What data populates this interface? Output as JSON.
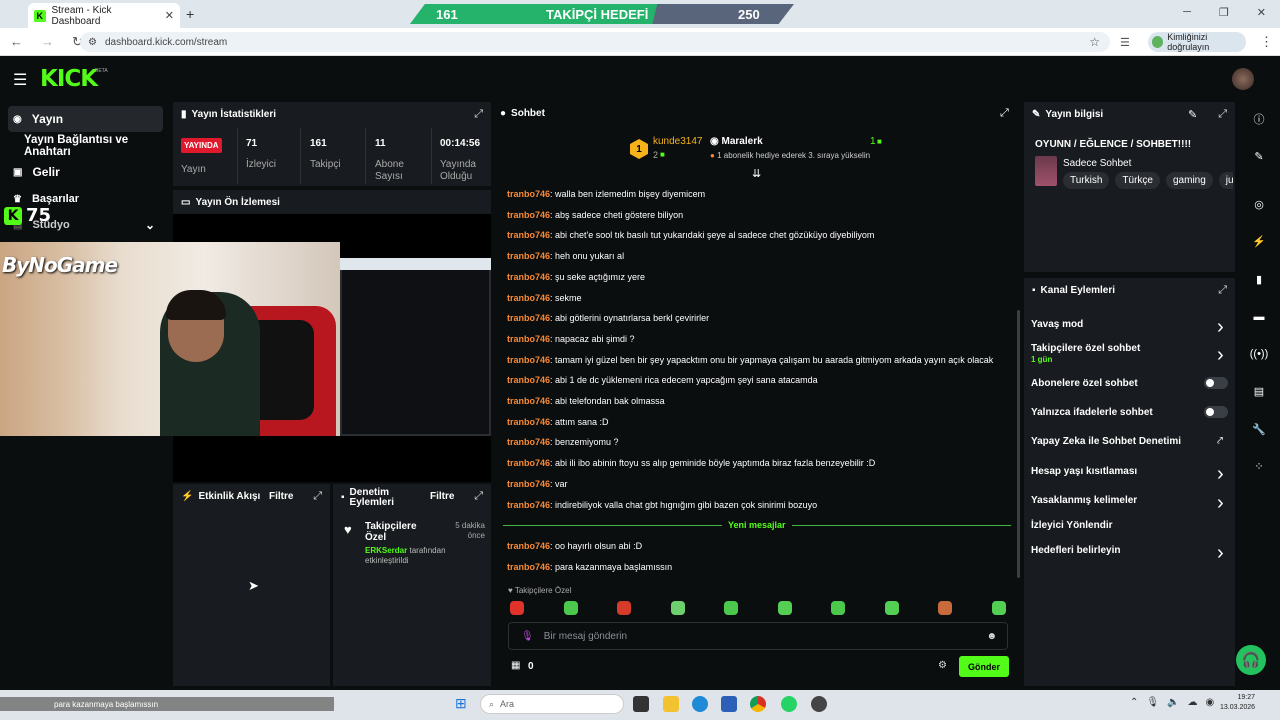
{
  "browser": {
    "tab_title": "Stream - Kick Dashboard",
    "url": "dashboard.kick.com/stream",
    "verify_label": "Kimliğinizi doğrulayın",
    "close_glyph": "✕",
    "newtab_glyph": "+"
  },
  "goal": {
    "current": "161",
    "label": "TAKİPÇİ HEDEFİ",
    "target": "250",
    "progress": 0.644
  },
  "kick": {
    "logo": "KICK",
    "beta": "BETA"
  },
  "sidebar": {
    "items": [
      {
        "label": "Yayın",
        "icon": "broadcast-icon"
      },
      {
        "label": "Yayın Bağlantısı ve Anahtarı",
        "icon": ""
      },
      {
        "label": "Gelir",
        "icon": "money-icon"
      },
      {
        "label": "Başarılar",
        "icon": "trophy-icon"
      },
      {
        "label": "Stüdyo",
        "icon": "studio-icon"
      }
    ],
    "overlay_count": "75"
  },
  "stats": {
    "title": "Yayın İstatistikleri",
    "live_badge": "YAYINDA",
    "live_label": "Yayın",
    "items": [
      {
        "value": "71",
        "label": "İzleyici"
      },
      {
        "value": "161",
        "label": "Takipçi"
      },
      {
        "value": "11",
        "label": "Abone Sayısı"
      },
      {
        "value": "00:14:56",
        "label": "Yayında Olduğu"
      }
    ]
  },
  "preview": {
    "title": "Yayın Ön İzlemesi",
    "watermark": "ByNoGame"
  },
  "activity": {
    "title": "Etkinlik Akışı",
    "filter": "Filtre"
  },
  "mod_actions": {
    "title": "Denetim Eylemleri",
    "filter": "Filtre",
    "item_title": "Takipçilere Özel",
    "item_time": "5 dakika önce",
    "item_user": "ERKSerdar",
    "item_desc": "tarafından etkinleştirildi"
  },
  "chat": {
    "title": "Sohbet",
    "top_gifter_rank": "1",
    "top_gifter_name": "kunde3147",
    "top_gifter_count": "2",
    "sub_user": "Maralerk",
    "sub_count": "1",
    "sub_text": "1 abonelik hediye ederek 3. sıraya yükselin",
    "messages": [
      {
        "user": "tranbo746",
        "text": ": walla ben izlemedim bişey diyemicem"
      },
      {
        "user": "tranbo746",
        "text": ": abş sadece cheti göstere biliyon"
      },
      {
        "user": "tranbo746",
        "text": ": abi chet'e sool tık basılı tut yukarıdaki şeye al sadece chet gözüküyo diyebiliyom"
      },
      {
        "user": "tranbo746",
        "text": ": heh onu yukarı al"
      },
      {
        "user": "tranbo746",
        "text": ": şu seke açtığımız yere"
      },
      {
        "user": "tranbo746",
        "text": ": sekme"
      },
      {
        "user": "tranbo746",
        "text": ": abi götlerini oynatırlarsa berkl çevirirler"
      },
      {
        "user": "tranbo746",
        "text": ": napacaz abi şimdi ?"
      },
      {
        "user": "tranbo746",
        "text": ": tamam iyi güzel ben bir şey yapacktım onu bir yapmaya çalışam bu aarada gitmiyom arkada yayın açık olacak"
      },
      {
        "user": "tranbo746",
        "text": ": abi 1 de dc yüklemeni rica edecem yapcağım şeyi sana atacamda"
      },
      {
        "user": "tranbo746",
        "text": ": abi telefondan bak olmassa"
      },
      {
        "user": "tranbo746",
        "text": ": attım sana :D"
      },
      {
        "user": "tranbo746",
        "text": ": benzemiyomu ?"
      },
      {
        "user": "tranbo746",
        "text": ": abi ili ibo abinin ftoyu ss alıp geminide böyle yaptımda biraz fazla benzeyebilir :D"
      },
      {
        "user": "tranbo746",
        "text": ": var"
      },
      {
        "user": "tranbo746",
        "text": ": indirebiliyok valla chat gbt hıgnığım gibi bazen çok sinirimi bozuyo"
      }
    ],
    "new_messages_label": "Yeni mesajlar",
    "new_messages": [
      {
        "user": "tranbo746",
        "text": ": oo hayırlı olsun abi :D"
      },
      {
        "user": "tranbo746",
        "text": ": para kazanmaya başlamıssın"
      }
    ],
    "mode_label": "Takipçilere Özel",
    "input_placeholder": "Bir mesaj gönderin",
    "points": "0",
    "send_label": "Gönder"
  },
  "stream_info": {
    "title": "Yayın bilgisi",
    "stream_title": "OYUNN / EĞLENCE / SOHBET!!!!",
    "category": "Sadece Sohbet",
    "tags": [
      "Turkish",
      "Türkçe",
      "gaming",
      "jus"
    ]
  },
  "channel_actions": {
    "title": "Kanal Eylemleri",
    "items": [
      {
        "label": "Yavaş mod",
        "control": "chevron"
      },
      {
        "label": "Takipçilere özel sohbet",
        "sub": "1 gün",
        "control": "chevron"
      },
      {
        "label": "Abonelere özel sohbet",
        "control": "toggle"
      },
      {
        "label": "Yalnızca ifadelerle sohbet",
        "control": "toggle"
      },
      {
        "label": "Yapay Zeka ile Sohbet Denetimi",
        "control": "external"
      },
      {
        "label": "Hesap yaşı kısıtlaması",
        "control": "chevron"
      },
      {
        "label": "Yasaklanmış kelimeler",
        "control": "chevron"
      },
      {
        "label": "İzleyici Yönlendir",
        "control": "none"
      },
      {
        "label": "Hedefleri belirleyin",
        "control": "chevron"
      }
    ]
  },
  "taskbar": {
    "ticker_text": "para kazanmaya başlamıssın",
    "search_placeholder": "Ara",
    "time": "19:27",
    "date": "13.03.2026"
  },
  "colors": {
    "brand": "#53fc18",
    "live": "#e0192d",
    "username": "#f98a35"
  }
}
